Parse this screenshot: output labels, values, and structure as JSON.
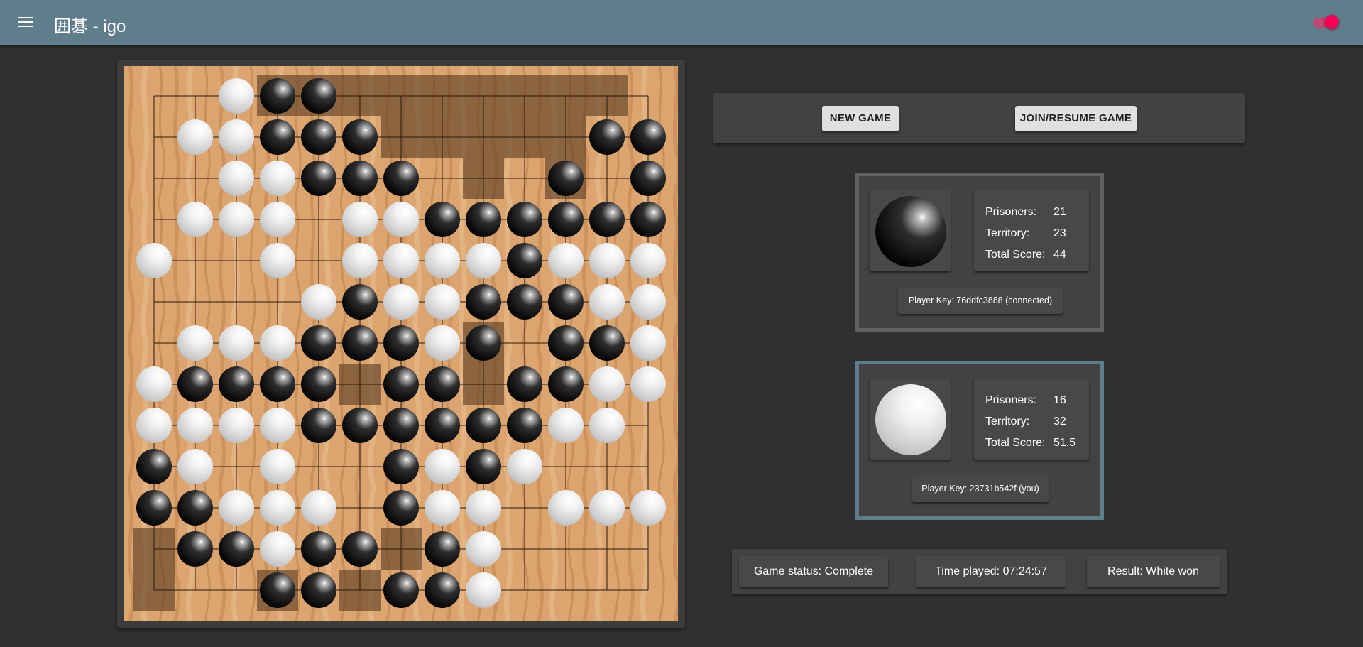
{
  "app": {
    "title": "囲碁 - igo",
    "menu_icon": "menu-icon",
    "theme_toggle_on": true,
    "accent_color": "#607d8b",
    "toggle_color": "#f50057"
  },
  "board": {
    "size": 13,
    "rows": [
      "..WBB........",
      ".WWBBB.....BB",
      "..WWBBB...B.B",
      ".WWW.WWBBBBBB",
      "W..W.WWWWBWWW",
      "....WBWWBBBWW",
      ".WWWBBBWB.BBW",
      "WBBBB.BB.BBWW",
      "WWWWBBBBBBWW.",
      "BW.W..BWBW...",
      "BBWWW.BWW.WWW",
      ".BBWBB.BW....",
      "...BB.BBW...."
    ],
    "territory_rows": [
      "...ooooooooo.",
      "......ooooo..",
      "........o.o..",
      ".............",
      ".............",
      ".............",
      "........o....",
      ".....o..o....",
      ".............",
      ".............",
      ".............",
      "o.....o......",
      "o..o.o......."
    ],
    "colors": {
      "black": "#000000",
      "white": "#ffffff",
      "wood": "#d49a62",
      "territory": "#5a3e22"
    }
  },
  "controls": {
    "new_game_label": "NEW GAME",
    "join_resume_label": "JOIN/RESUME GAME"
  },
  "players": {
    "black": {
      "stone_color": "black",
      "prisoners_label": "Prisoners:",
      "prisoners": "21",
      "territory_label": "Territory:",
      "territory": "23",
      "total_label": "Total Score:",
      "total": "44",
      "key_text": "Player Key: 76ddfc3888",
      "status_text": "(connected)"
    },
    "white": {
      "stone_color": "white",
      "active": true,
      "prisoners_label": "Prisoners:",
      "prisoners": "16",
      "territory_label": "Territory:",
      "territory": "32",
      "total_label": "Total Score:",
      "total": "51.5",
      "key_text": "Player Key: 23731b542f",
      "status_text": "(you)"
    }
  },
  "status": {
    "game_status": "Game status: Complete",
    "time_played": "Time played: 07:24:57",
    "result": "Result: White won"
  }
}
